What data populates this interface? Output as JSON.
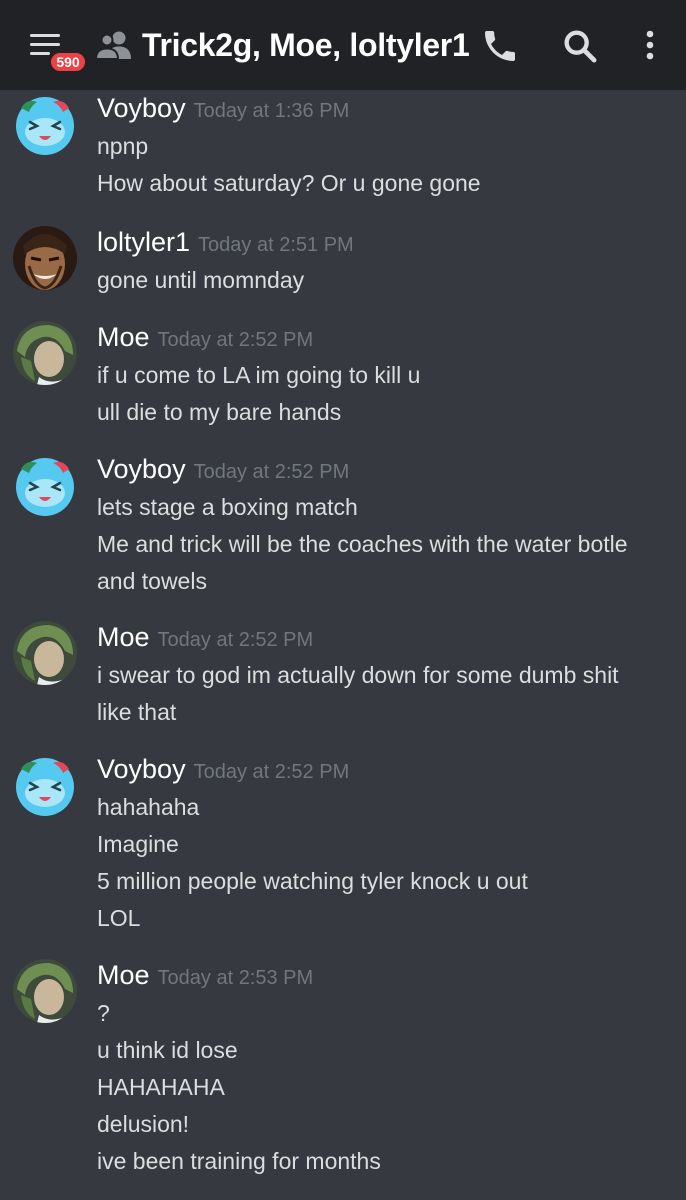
{
  "header": {
    "unread_count": "590",
    "channel_title": "Trick2g, Moe, loltyler1"
  },
  "colors": {
    "header_bg": "#202225",
    "chat_bg": "#36393f",
    "badge": "#ed4245",
    "username": "#ffffff",
    "timestamp": "#72767d",
    "message_text": "#dcddde"
  },
  "messages": [
    {
      "author": "Voyboy",
      "avatar": "blue-cat-avatar",
      "time": "Today at 1:36 PM",
      "lines": [
        "npnp",
        "How about saturday? Or u gone gone"
      ]
    },
    {
      "author": "loltyler1",
      "avatar": "draven-avatar",
      "time": "Today at 2:51 PM",
      "lines": [
        "gone until momnday"
      ]
    },
    {
      "author": "Moe",
      "avatar": "green-hair-avatar",
      "time": "Today at 2:52 PM",
      "lines": [
        "if u come to LA im going to kill u",
        "ull die to my bare hands"
      ]
    },
    {
      "author": "Voyboy",
      "avatar": "blue-cat-avatar",
      "time": "Today at 2:52 PM",
      "lines": [
        "lets stage a boxing match",
        "Me and trick will be the coaches with the water botle",
        "and towels"
      ]
    },
    {
      "author": "Moe",
      "avatar": "green-hair-avatar",
      "time": "Today at 2:52 PM",
      "lines": [
        "i swear to god im actually down for some dumb shit",
        "like that"
      ]
    },
    {
      "author": "Voyboy",
      "avatar": "blue-cat-avatar",
      "time": "Today at 2:52 PM",
      "lines": [
        "hahahaha",
        "Imagine",
        "5 million people watching tyler knock u out",
        "LOL"
      ]
    },
    {
      "author": "Moe",
      "avatar": "green-hair-avatar",
      "time": "Today at 2:53 PM",
      "lines": [
        "?",
        "u think id lose",
        "HAHAHAHA",
        "delusion!",
        "ive been training for months"
      ]
    }
  ]
}
